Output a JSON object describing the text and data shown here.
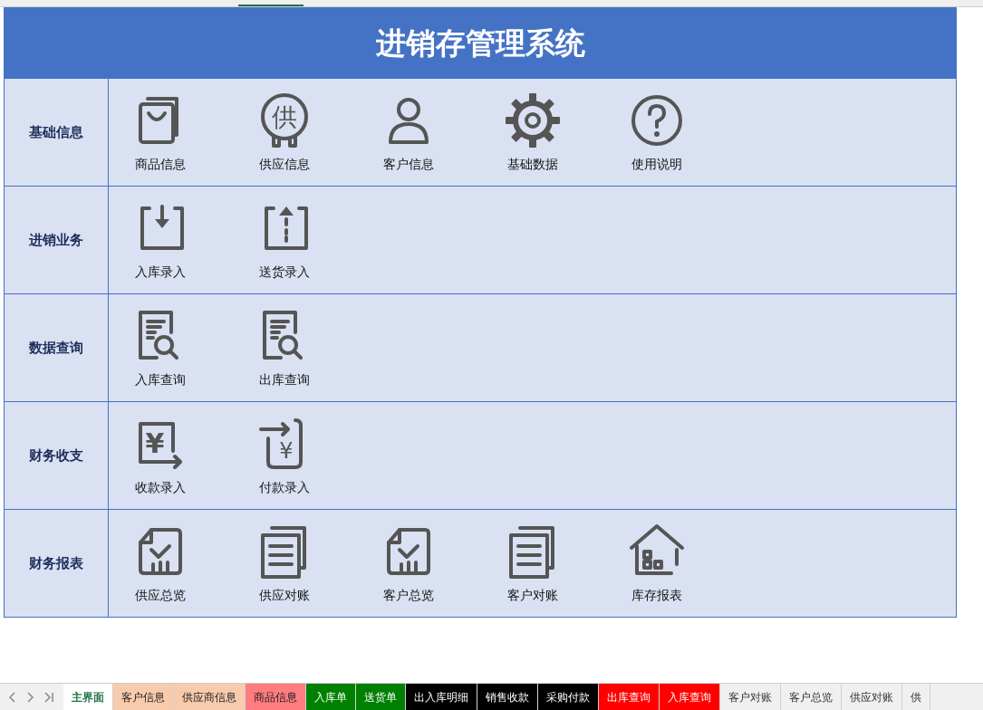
{
  "title": "进销存管理系统",
  "sections": [
    {
      "label": "基础信息",
      "items": [
        {
          "label": "商品信息",
          "kind": "bag"
        },
        {
          "label": "供应信息",
          "kind": "seal",
          "glyph": "供"
        },
        {
          "label": "客户信息",
          "kind": "person"
        },
        {
          "label": "基础数据",
          "kind": "gear"
        },
        {
          "label": "使用说明",
          "kind": "question"
        }
      ]
    },
    {
      "label": "进销业务",
      "items": [
        {
          "label": "入库录入",
          "kind": "tray-down"
        },
        {
          "label": "送货录入",
          "kind": "tray-up"
        }
      ]
    },
    {
      "label": "数据查询",
      "items": [
        {
          "label": "入库查询",
          "kind": "doc-search"
        },
        {
          "label": "出库查询",
          "kind": "doc-search"
        }
      ]
    },
    {
      "label": "财务收支",
      "items": [
        {
          "label": "收款录入",
          "kind": "yen-in",
          "glyph": "¥"
        },
        {
          "label": "付款录入",
          "kind": "yen-out",
          "glyph": "¥"
        }
      ]
    },
    {
      "label": "财务报表",
      "items": [
        {
          "label": "供应总览",
          "kind": "doc-check"
        },
        {
          "label": "供应对账",
          "kind": "docs"
        },
        {
          "label": "客户总览",
          "kind": "doc-check"
        },
        {
          "label": "客户对账",
          "kind": "docs"
        },
        {
          "label": "库存报表",
          "kind": "house"
        }
      ]
    }
  ],
  "sheet_tabs": [
    {
      "label": "主界面",
      "selected": true
    },
    {
      "label": "客户信息",
      "selected": false,
      "color": "#f8cbad"
    },
    {
      "label": "供应商信息",
      "selected": false,
      "color": "#f8cbad"
    },
    {
      "label": "商品信息",
      "selected": false,
      "color": "#ff7c80"
    },
    {
      "label": "入库单",
      "selected": false,
      "color": "#008000"
    },
    {
      "label": "送货单",
      "selected": false,
      "color": "#008000"
    },
    {
      "label": "出入库明细",
      "selected": false,
      "color": "#000000"
    },
    {
      "label": "销售收款",
      "selected": false,
      "color": "#000000"
    },
    {
      "label": "采购付款",
      "selected": false,
      "color": "#000000"
    },
    {
      "label": "出库查询",
      "selected": false,
      "color": "#ff0000"
    },
    {
      "label": "入库查询",
      "selected": false,
      "color": "#ff0000"
    },
    {
      "label": "客户对账",
      "selected": false
    },
    {
      "label": "客户总览",
      "selected": false
    },
    {
      "label": "供应对账",
      "selected": false
    },
    {
      "label": "供",
      "selected": false
    }
  ]
}
